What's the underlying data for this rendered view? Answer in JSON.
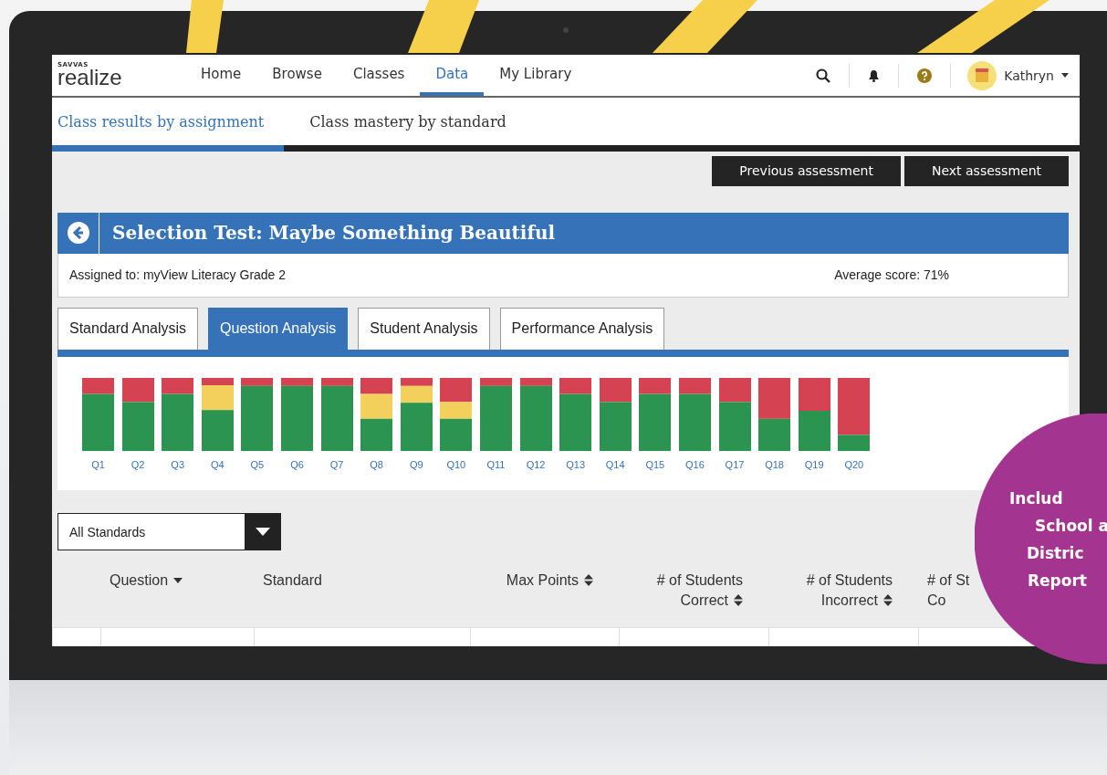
{
  "nav": {
    "logo_brand": "SAVVAS",
    "logo_name": "realize",
    "items": [
      {
        "label": "Home",
        "selected": false
      },
      {
        "label": "Browse",
        "selected": false
      },
      {
        "label": "Classes",
        "selected": false
      },
      {
        "label": "Data",
        "selected": true
      },
      {
        "label": "My Library",
        "selected": false
      }
    ],
    "user": {
      "name": "Kathryn"
    }
  },
  "subnav": {
    "items": [
      {
        "label": "Class results by assignment",
        "selected": true
      },
      {
        "label": "Class mastery by standard",
        "selected": false
      }
    ]
  },
  "toolbar": {
    "buttons": [
      "Previous assessment",
      "Next assessment"
    ]
  },
  "assessment": {
    "title": "Selection Test: Maybe Something Beautiful",
    "assigned_to": "Assigned to: myView Literacy Grade 2",
    "average_score": "Average score: 71%"
  },
  "analysis_tabs": [
    {
      "label": "Standard Analysis",
      "selected": false
    },
    {
      "label": "Question Analysis",
      "selected": true
    },
    {
      "label": "Student Analysis",
      "selected": false
    },
    {
      "label": "Performance Analysis",
      "selected": false
    }
  ],
  "chart": {
    "categories": [
      "Q1",
      "Q2",
      "Q3",
      "Q4",
      "Q5",
      "Q6",
      "Q7",
      "Q8",
      "Q9",
      "Q10",
      "Q11",
      "Q12",
      "Q13",
      "Q14",
      "Q15",
      "Q16",
      "Q17",
      "Q18",
      "Q19",
      "Q20"
    ]
  },
  "filter": {
    "value": "All Standards"
  },
  "table": {
    "columns": [
      {
        "lines": [
          "Question"
        ],
        "kind": "dropdown"
      },
      {
        "lines": [
          "Standard"
        ],
        "kind": "plain"
      },
      {
        "lines": [
          "Max Points"
        ],
        "kind": "sortable"
      },
      {
        "lines": [
          "# of Students",
          "Correct"
        ],
        "kind": "sortable"
      },
      {
        "lines": [
          "# of Students",
          "Incorrect"
        ],
        "kind": "sortable"
      },
      {
        "lines": [
          "# of St",
          "Co"
        ],
        "kind": "plain"
      }
    ]
  },
  "callout": {
    "lines": [
      "Includ",
      "School a",
      "Distric",
      "Report"
    ]
  }
}
